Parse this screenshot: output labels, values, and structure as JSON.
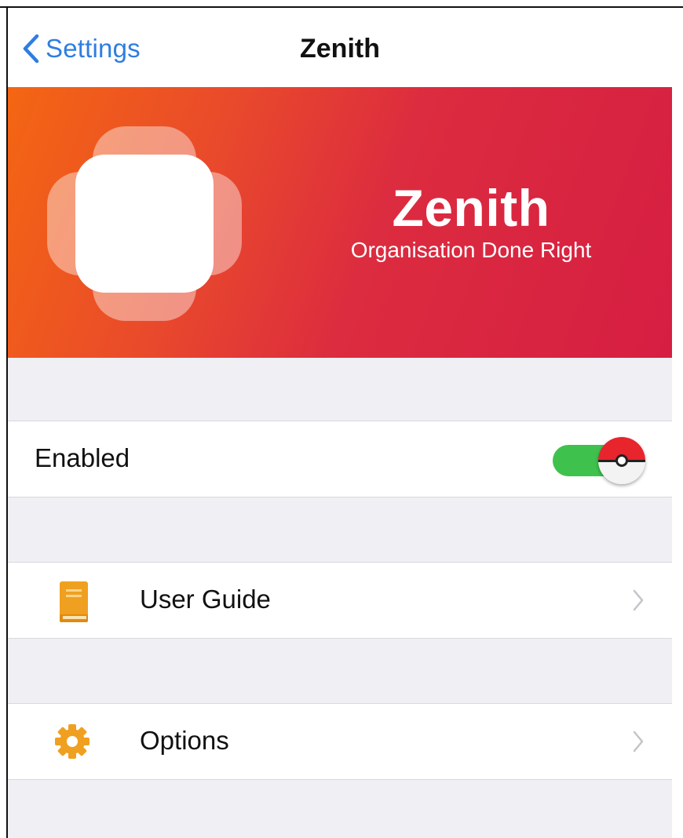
{
  "navbar": {
    "back_label": "Settings",
    "title": "Zenith"
  },
  "banner": {
    "name": "Zenith",
    "tagline": "Organisation Done Right",
    "gradient_start": "#f46613",
    "gradient_end": "#d61e42"
  },
  "rows": {
    "enabled": {
      "label": "Enabled",
      "on": true
    },
    "user_guide": {
      "label": "User Guide",
      "icon": "book-icon"
    },
    "options": {
      "label": "Options",
      "icon": "gear-icon"
    }
  },
  "colors": {
    "accent": "#2f7de1",
    "toggle_on": "#3ec24d",
    "icon_orange": "#f0a020"
  }
}
